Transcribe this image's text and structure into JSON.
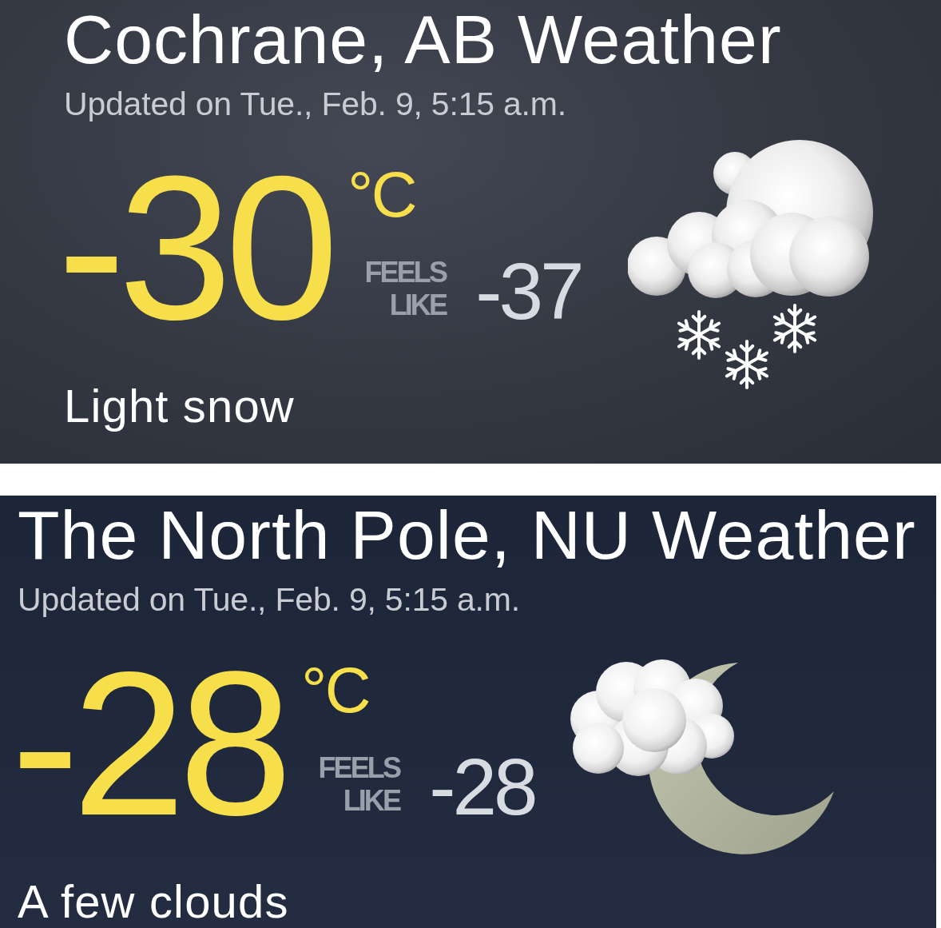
{
  "panels": [
    {
      "kind": "snow",
      "title": "Cochrane, AB Weather",
      "updated": "Updated on Tue., Feb. 9, 5:15 a.m.",
      "temperature": "-30",
      "unit": "°C",
      "feels_like_label": "FEELS LIKE",
      "feels_like": "-37",
      "condition": "Light snow"
    },
    {
      "kind": "night-clouds",
      "title": "The North Pole, NU Weather",
      "updated": "Updated on Tue., Feb. 9, 5:15 a.m.",
      "temperature": "-28",
      "unit": "°C",
      "feels_like_label": "FEELS LIKE",
      "feels_like": "-28",
      "condition": "A few clouds"
    }
  ]
}
